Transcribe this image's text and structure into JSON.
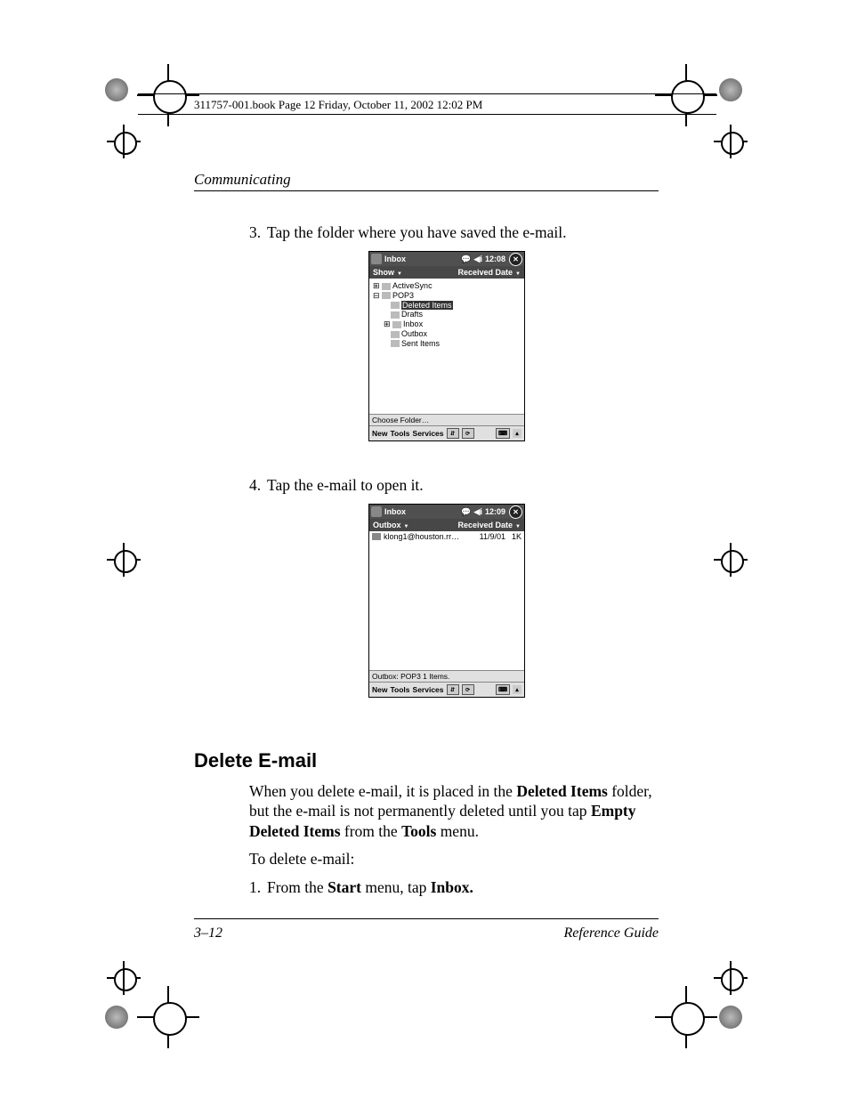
{
  "header_line": "311757-001.book  Page 12  Friday, October 11, 2002  12:02 PM",
  "section_header": "Communicating",
  "step3": "Tap the folder where you have saved the e-mail.",
  "step4": "Tap the e-mail to open it.",
  "delete_title": "Delete E-mail",
  "delete_para_parts": {
    "p1a": "When you delete e-mail, it is placed in the ",
    "p1b": "Deleted Items",
    "p1c": " folder, but the e-mail is not permanently deleted until you tap ",
    "p1d": "Empty Deleted Items",
    "p1e": " from the ",
    "p1f": "Tools",
    "p1g": " menu."
  },
  "delete_intro": "To delete e-mail:",
  "delete_step1_a": "From the ",
  "delete_step1_b": "Start",
  "delete_step1_c": " menu, tap ",
  "delete_step1_d": "Inbox.",
  "footer_page": "3–12",
  "footer_title": "Reference Guide",
  "ss1": {
    "title": "Inbox",
    "time": "12:08",
    "sub_left": "Show",
    "sub_right": "Received Date",
    "tree": {
      "a": "ActiveSync",
      "b": "POP3",
      "c": "Deleted Items",
      "d": "Drafts",
      "e": "Inbox",
      "f": "Outbox",
      "g": "Sent Items"
    },
    "choose": "Choose Folder…",
    "bb_new": "New",
    "bb_tools": "Tools",
    "bb_services": "Services"
  },
  "ss2": {
    "title": "Inbox",
    "time": "12:09",
    "sub_left": "Outbox",
    "sub_right": "Received Date",
    "row": {
      "from": "klong1@houston.rr…",
      "date": "11/9/01",
      "size": "1K"
    },
    "status": "Outbox: POP3  1 Items.",
    "bb_new": "New",
    "bb_tools": "Tools",
    "bb_services": "Services"
  }
}
